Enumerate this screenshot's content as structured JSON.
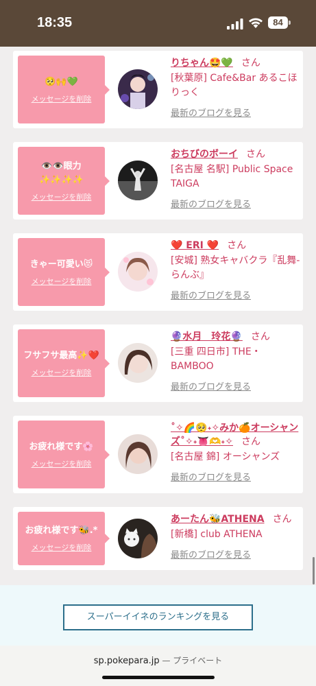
{
  "status": {
    "time": "18:35",
    "battery": "84"
  },
  "cards": [
    {
      "message": "🥺🙌💚",
      "delete_label": "メッセージを削除",
      "name": "りちゃん🤩💚",
      "san": "さん",
      "shop": "[秋葉原] Cafe&Bar あるこほりっく",
      "blog": "最新のブログを見る"
    },
    {
      "message": "👁️👁️眼力✨✨✨✨",
      "delete_label": "メッセージを削除",
      "name": "おちびのボーイ",
      "san": "さん",
      "shop": "[名古屋 名駅] Public Space TAIGA",
      "blog": "最新のブログを見る"
    },
    {
      "message": "きゃー可愛い😻",
      "delete_label": "メッセージを削除",
      "name": "❤️ ERI ❤️",
      "san": "さん",
      "shop": "[安城] 熟女キャバクラ『乱舞-らんぶ』",
      "blog": "最新のブログを見る"
    },
    {
      "message": "フサフサ最高✨❤️",
      "delete_label": "メッセージを削除",
      "name": "🔮水月　玲花🔮",
      "san": "さん",
      "shop": "[三重 四日市] THE・BAMBOO",
      "blog": "最新のブログを見る"
    },
    {
      "message": "お疲れ様です🌸",
      "delete_label": "メッセージを削除",
      "name": "˚✧🌈🥺˖✧みか🍊オーシャンズ˚✧˖👅🫶˖✧",
      "san": "さん",
      "shop": "[名古屋 錦] オーシャンズ",
      "blog": "最新のブログを見る"
    },
    {
      "message": "お疲れ様です🐝.*",
      "delete_label": "メッセージを削除",
      "name": "あーたん🐝ATHENA",
      "san": "さん",
      "shop": "[新橋] club ATHENA",
      "blog": "最新のブログを見る"
    }
  ],
  "ranking_button": "スーパーイイネのランキングを見る",
  "url": {
    "domain": "sp.pokepara.jp",
    "suffix": " — プライベート"
  },
  "colors": {
    "accent": "#cc3b5e",
    "bubble": "#f79aab",
    "status_bar": "#5a4838",
    "button": "#2b6e8a"
  }
}
